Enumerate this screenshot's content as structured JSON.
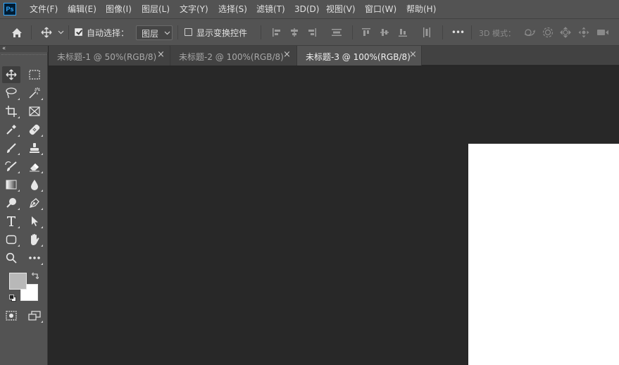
{
  "app": {
    "logo": "Ps"
  },
  "menu": [
    "文件(F)",
    "编辑(E)",
    "图像(I)",
    "图层(L)",
    "文字(Y)",
    "选择(S)",
    "滤镜(T)",
    "3D(D)",
    "视图(V)",
    "窗口(W)",
    "帮助(H)"
  ],
  "options": {
    "auto_select_label": "自动选择：",
    "auto_select_checked": true,
    "layer_select_value": "图层",
    "show_transform_label": "显示变换控件",
    "show_transform_checked": false,
    "more_label": "•••",
    "mode_3d_label": "3D 模式："
  },
  "tabs": [
    {
      "title": "未标题-1 @ 50%(RGB/8)",
      "active": false
    },
    {
      "title": "未标题-2 @ 100%(RGB/8)",
      "active": false
    },
    {
      "title": "未标题-3 @ 100%(RGB/8)",
      "active": true
    }
  ],
  "tab_close": "×",
  "panel": {
    "collapse": "‹‹"
  },
  "colors": {
    "foreground": "#b8b8b8",
    "background": "#ffffff",
    "ui_panel": "#535353",
    "workspace": "#282828",
    "canvas": "#ffffff"
  },
  "icons": {
    "toolbar": [
      "home-icon",
      "move-icon",
      "align-left-icon",
      "align-center-h-icon",
      "align-right-icon",
      "distribute-h-icon",
      "align-top-icon",
      "align-middle-v-icon",
      "align-bottom-icon",
      "distribute-v-icon",
      "more-icon",
      "orbit-3d-icon",
      "roll-3d-icon",
      "pan-3d-icon",
      "slide-3d-icon",
      "scale-3d-icon"
    ],
    "tools": [
      "move-tool-icon",
      "marquee-tool-icon",
      "lasso-tool-icon",
      "magic-wand-tool-icon",
      "crop-tool-icon",
      "frame-tool-icon",
      "eyedropper-tool-icon",
      "healing-brush-tool-icon",
      "brush-tool-icon",
      "clone-stamp-tool-icon",
      "history-brush-tool-icon",
      "eraser-tool-icon",
      "gradient-tool-icon",
      "blur-tool-icon",
      "dodge-tool-icon",
      "pen-tool-icon",
      "type-tool-icon",
      "path-selection-tool-icon",
      "rectangle-tool-icon",
      "hand-tool-icon",
      "zoom-tool-icon",
      "more-tools-icon",
      "quick-mask-icon",
      "screen-mode-icon"
    ]
  }
}
